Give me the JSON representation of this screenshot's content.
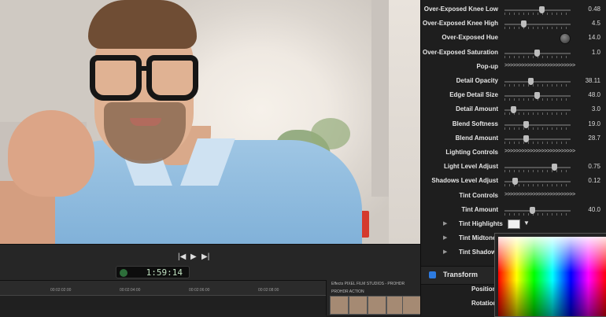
{
  "transport": {
    "timecode": "1:59:14",
    "prev_icon": "|◀",
    "play_icon": "▶",
    "next_icon": "▶|"
  },
  "timeline": {
    "ruler": [
      "00:02:02:00",
      "00:02:04:00",
      "00:02:06:00",
      "00:02:08:00"
    ]
  },
  "effects": {
    "header": "Effects  PIXEL FILM STUDIOS - PROHDR",
    "category": "PROHDR ACTION"
  },
  "inspector": {
    "rows": [
      {
        "label": "Over-Exposed Knee Low",
        "type": "slider",
        "value": "0.48",
        "pos": 0.55
      },
      {
        "label": "Over-Exposed Knee High",
        "type": "slider",
        "value": "4.5",
        "pos": 0.26
      },
      {
        "label": "Over-Exposed Hue",
        "type": "dial",
        "value": "14.0"
      },
      {
        "label": "Over-Exposed Saturation",
        "type": "slider",
        "value": "1.0",
        "pos": 0.48
      },
      {
        "label": "Pop-up",
        "type": "arrows",
        "value": ">>>>>>>>>>>>>>>>>>>>>>>>>"
      },
      {
        "label": "Detail Opacity",
        "type": "slider",
        "value": "38.11",
        "pos": 0.38
      },
      {
        "label": "Edge Detail Size",
        "type": "slider",
        "value": "48.0",
        "pos": 0.48
      },
      {
        "label": "Detail Amount",
        "type": "slider",
        "value": "3.0",
        "pos": 0.1
      },
      {
        "label": "Blend Softness",
        "type": "slider",
        "value": "19.0",
        "pos": 0.3
      },
      {
        "label": "Blend Amount",
        "type": "slider",
        "value": "28.7",
        "pos": 0.3
      },
      {
        "label": "Lighting Controls",
        "type": "arrows",
        "value": ">>>>>>>>>>>>>>>>>>>>>>>>>"
      },
      {
        "label": "Light Level Adjust",
        "type": "slider",
        "value": "0.75",
        "pos": 0.75
      },
      {
        "label": "Shadows Level Adjust",
        "type": "slider",
        "value": "0.12",
        "pos": 0.12
      },
      {
        "label": "Tint Controls",
        "type": "arrows",
        "value": ">>>>>>>>>>>>>>>>>>>>>>>>>"
      },
      {
        "label": "Tint Amount",
        "type": "slider",
        "value": "40.0",
        "pos": 0.4
      }
    ],
    "tint_rows": [
      "Tint Highlights",
      "Tint Midtone",
      "Tint Shadow"
    ],
    "transform_title": "Transform",
    "transform_rows": [
      "Position",
      "Rotation"
    ]
  }
}
